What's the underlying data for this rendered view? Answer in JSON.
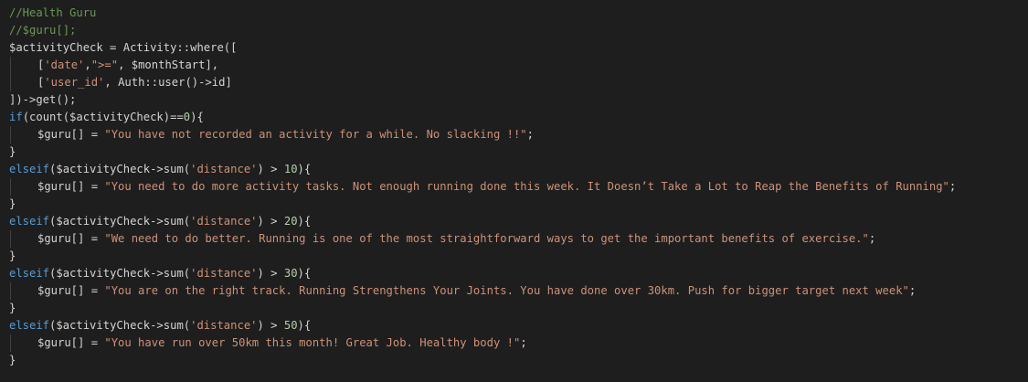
{
  "theme": {
    "background": "#1e1e1e",
    "text": "#d4d4d4",
    "comment": "#6a9955",
    "keyword": "#569cd6",
    "string": "#ce9178",
    "number": "#b5cea8"
  },
  "lines": [
    {
      "indent": 0,
      "tokens": [
        {
          "type": "comment",
          "text": "//Health Guru"
        }
      ]
    },
    {
      "indent": 0,
      "tokens": [
        {
          "type": "comment",
          "text": "//$guru[];"
        }
      ]
    },
    {
      "indent": 0,
      "tokens": [
        {
          "type": "plain",
          "text": "$activityCheck = Activity::where(["
        }
      ]
    },
    {
      "indent": 1,
      "tokens": [
        {
          "type": "plain",
          "text": "["
        },
        {
          "type": "string",
          "text": "'date'"
        },
        {
          "type": "plain",
          "text": ","
        },
        {
          "type": "string",
          "text": "\">=\""
        },
        {
          "type": "plain",
          "text": ", $monthStart],"
        }
      ]
    },
    {
      "indent": 1,
      "tokens": [
        {
          "type": "plain",
          "text": "["
        },
        {
          "type": "string",
          "text": "'user_id'"
        },
        {
          "type": "plain",
          "text": ", Auth::user()->id]"
        }
      ]
    },
    {
      "indent": 0,
      "tokens": [
        {
          "type": "plain",
          "text": "])->get();"
        }
      ]
    },
    {
      "indent": 0,
      "tokens": [
        {
          "type": "keyword",
          "text": "if"
        },
        {
          "type": "plain",
          "text": "(count($activityCheck)=="
        },
        {
          "type": "number",
          "text": "0"
        },
        {
          "type": "plain",
          "text": "){"
        }
      ]
    },
    {
      "indent": 1,
      "tokens": [
        {
          "type": "plain",
          "text": "$guru[] = "
        },
        {
          "type": "string",
          "text": "\"You have not recorded an activity for a while. No slacking !!\""
        },
        {
          "type": "plain",
          "text": ";"
        }
      ]
    },
    {
      "indent": 0,
      "tokens": [
        {
          "type": "plain",
          "text": "}"
        }
      ]
    },
    {
      "indent": 0,
      "tokens": [
        {
          "type": "keyword",
          "text": "elseif"
        },
        {
          "type": "plain",
          "text": "($activityCheck->sum("
        },
        {
          "type": "string",
          "text": "'distance'"
        },
        {
          "type": "plain",
          "text": ") > "
        },
        {
          "type": "number",
          "text": "10"
        },
        {
          "type": "plain",
          "text": "){"
        }
      ]
    },
    {
      "indent": 1,
      "tokens": [
        {
          "type": "plain",
          "text": "$guru[] = "
        },
        {
          "type": "string",
          "text": "\"You need to do more activity tasks. Not enough running done this week. It Doesn’t Take a Lot to Reap the Benefits of Running\""
        },
        {
          "type": "plain",
          "text": ";"
        }
      ]
    },
    {
      "indent": 0,
      "tokens": [
        {
          "type": "plain",
          "text": "}"
        }
      ]
    },
    {
      "indent": 0,
      "tokens": [
        {
          "type": "keyword",
          "text": "elseif"
        },
        {
          "type": "plain",
          "text": "($activityCheck->sum("
        },
        {
          "type": "string",
          "text": "'distance'"
        },
        {
          "type": "plain",
          "text": ") > "
        },
        {
          "type": "number",
          "text": "20"
        },
        {
          "type": "plain",
          "text": "){"
        }
      ]
    },
    {
      "indent": 1,
      "tokens": [
        {
          "type": "plain",
          "text": "$guru[] = "
        },
        {
          "type": "string",
          "text": "\"We need to do better. Running is one of the most straightforward ways to get the important benefits of exercise.\""
        },
        {
          "type": "plain",
          "text": ";"
        }
      ]
    },
    {
      "indent": 0,
      "tokens": [
        {
          "type": "plain",
          "text": "}"
        }
      ]
    },
    {
      "indent": 0,
      "tokens": [
        {
          "type": "keyword",
          "text": "elseif"
        },
        {
          "type": "plain",
          "text": "($activityCheck->sum("
        },
        {
          "type": "string",
          "text": "'distance'"
        },
        {
          "type": "plain",
          "text": ") > "
        },
        {
          "type": "number",
          "text": "30"
        },
        {
          "type": "plain",
          "text": "){"
        }
      ]
    },
    {
      "indent": 1,
      "tokens": [
        {
          "type": "plain",
          "text": "$guru[] = "
        },
        {
          "type": "string",
          "text": "\"You are on the right track. Running Strengthens Your Joints. You have done over 30km. Push for bigger target next week\""
        },
        {
          "type": "plain",
          "text": ";"
        }
      ]
    },
    {
      "indent": 0,
      "tokens": [
        {
          "type": "plain",
          "text": "}"
        }
      ]
    },
    {
      "indent": 0,
      "tokens": [
        {
          "type": "keyword",
          "text": "elseif"
        },
        {
          "type": "plain",
          "text": "($activityCheck->sum("
        },
        {
          "type": "string",
          "text": "'distance'"
        },
        {
          "type": "plain",
          "text": ") > "
        },
        {
          "type": "number",
          "text": "50"
        },
        {
          "type": "plain",
          "text": "){"
        }
      ]
    },
    {
      "indent": 1,
      "tokens": [
        {
          "type": "plain",
          "text": "$guru[] = "
        },
        {
          "type": "string",
          "text": "\"You have run over 50km this month! Great Job. Healthy body !\""
        },
        {
          "type": "plain",
          "text": ";"
        }
      ]
    },
    {
      "indent": 0,
      "tokens": [
        {
          "type": "plain",
          "text": "}"
        }
      ]
    }
  ]
}
